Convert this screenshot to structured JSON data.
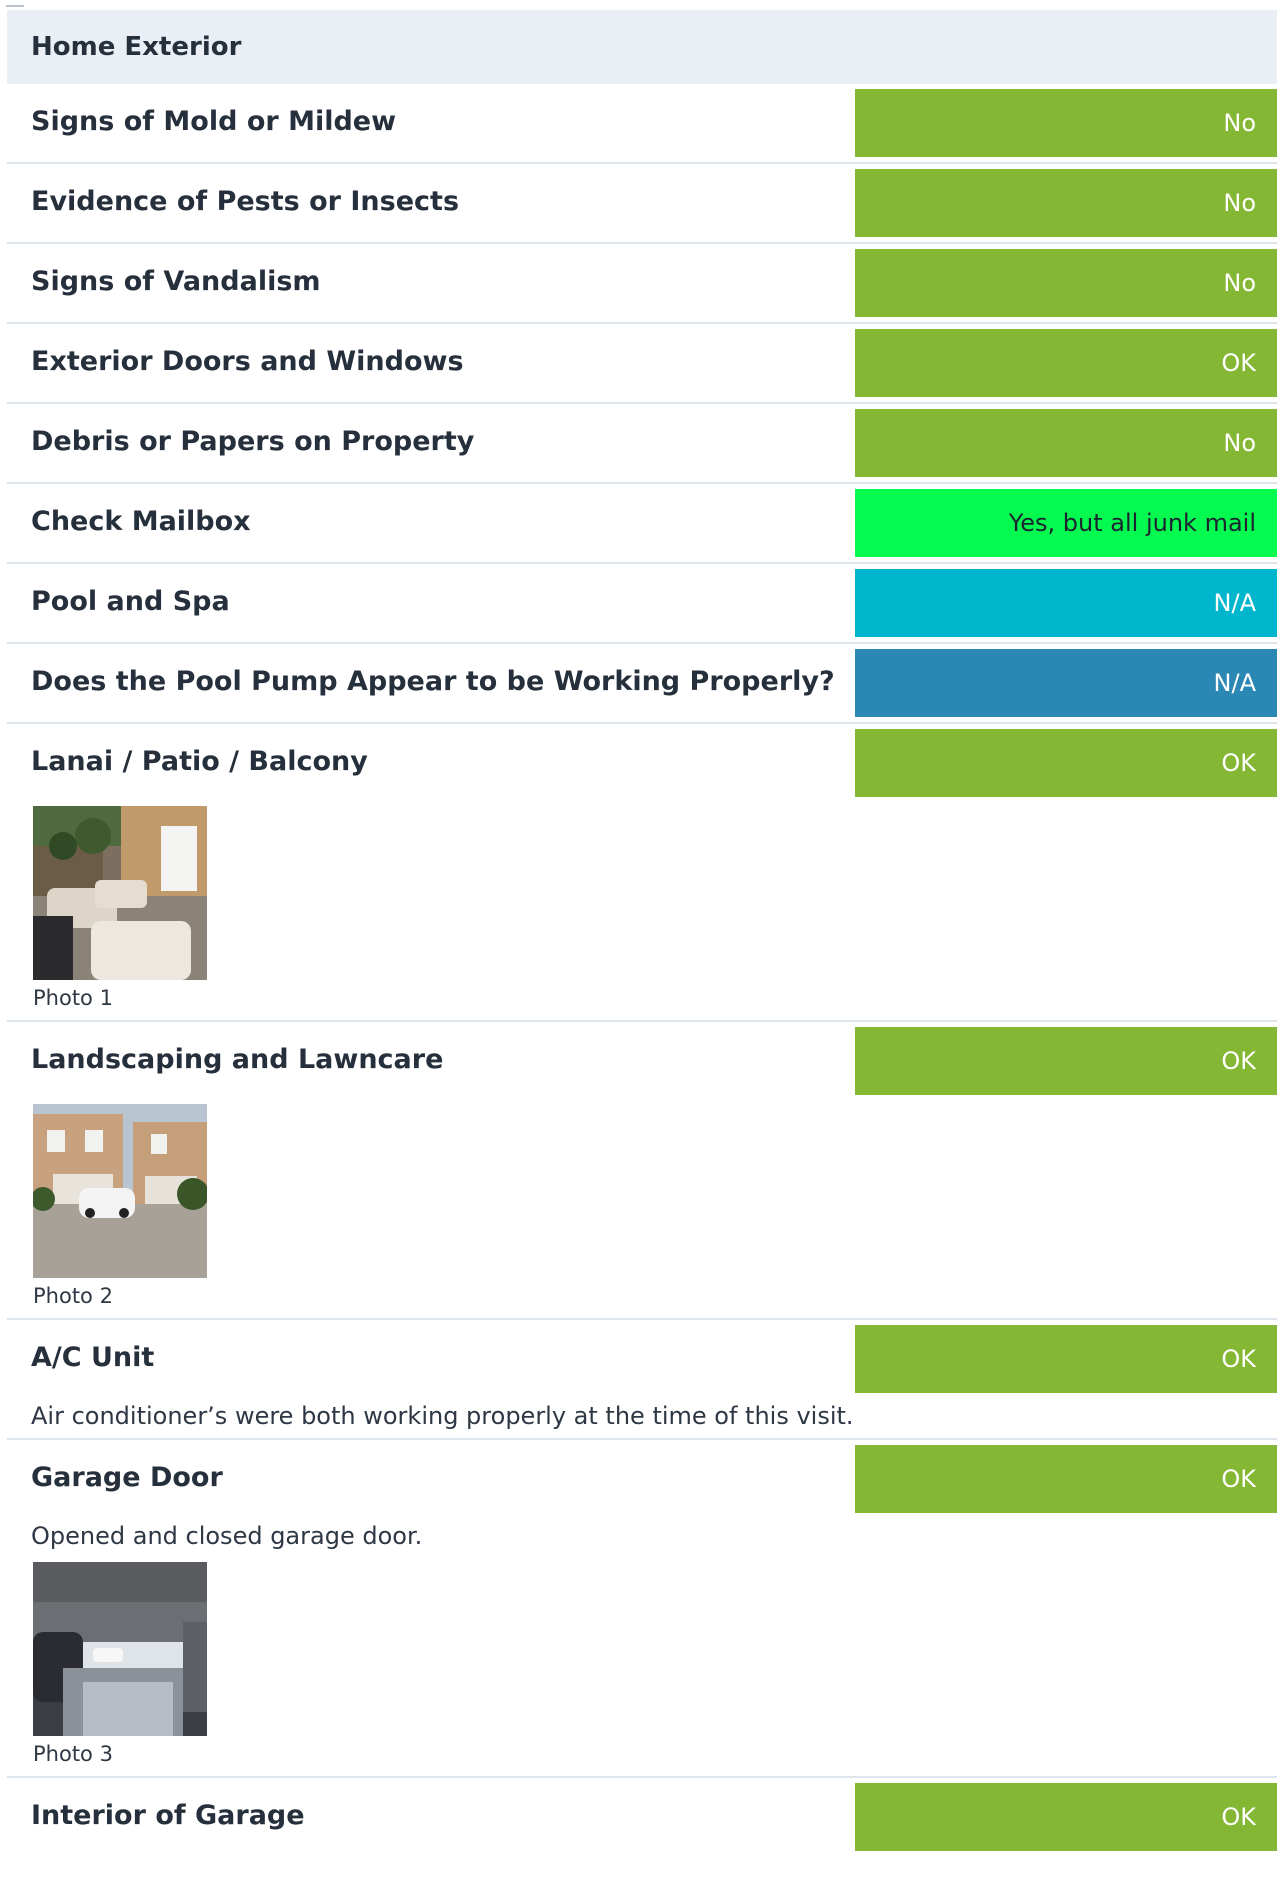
{
  "section": {
    "title": "Home Exterior"
  },
  "colors": {
    "ok_green": "#84b733",
    "bright_green": "#05fa4f",
    "teal": "#00b6cc",
    "blue": "#2b88b4"
  },
  "rows": [
    {
      "title": "Signs of Mold or Mildew",
      "status": "No",
      "color": "#84b733"
    },
    {
      "title": "Evidence of Pests or Insects",
      "status": "No",
      "color": "#84b733"
    },
    {
      "title": "Signs of Vandalism",
      "status": "No",
      "color": "#84b733"
    },
    {
      "title": "Exterior Doors and Windows",
      "status": "OK",
      "color": "#84b733"
    },
    {
      "title": "Debris or Papers on Property",
      "status": "No",
      "color": "#84b733"
    },
    {
      "title": "Check Mailbox",
      "status": "Yes, but all junk mail",
      "color": "#05fa4f"
    },
    {
      "title": "Pool and Spa",
      "status": "N/A",
      "color": "#00b6cc"
    },
    {
      "title": "Does the Pool Pump Appear to be Working Properly?",
      "status": "N/A",
      "color": "#2b88b4"
    },
    {
      "title": "Lanai / Patio / Balcony",
      "status": "OK",
      "color": "#84b733",
      "photo_caption": "Photo 1"
    },
    {
      "title": "Landscaping and  Lawncare",
      "status": "OK",
      "color": "#84b733",
      "photo_caption": "Photo 2"
    },
    {
      "title": "A/C Unit",
      "status": "OK",
      "color": "#84b733",
      "note": "Air conditioner’s were both working properly at the time of this visit."
    },
    {
      "title": "Garage Door",
      "status": "OK",
      "color": "#84b733",
      "note": "Opened and closed garage door.",
      "photo_caption": "Photo 3"
    },
    {
      "title": "Interior of Garage",
      "status": "OK",
      "color": "#84b733"
    }
  ]
}
